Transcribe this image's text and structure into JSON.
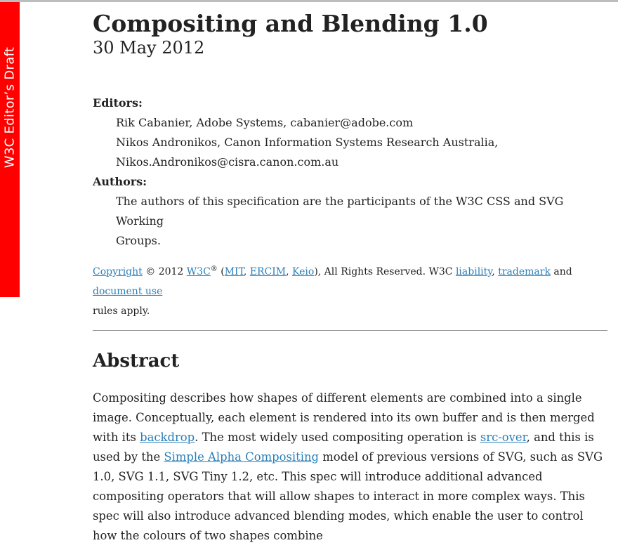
{
  "side_badge": {
    "text": "W3C Editor’s Draft",
    "color": "#ff0000"
  },
  "header": {
    "title": "Compositing and Blending 1.0",
    "date": "30 May 2012"
  },
  "meta": {
    "editors_label": "Editors:",
    "editor1": "Rik Cabanier, Adobe Systems, cabanier@adobe.com",
    "editor2_line1": "Nikos Andronikos, Canon Information Systems Research Australia,",
    "editor2_line2": "Nikos.Andronikos@cisra.canon.com.au",
    "authors_label": "Authors:",
    "authors_line1": "The authors of this specification are the participants of the W3C CSS and SVG Working",
    "authors_line2": "Groups."
  },
  "copyright": {
    "copyright_link": "Copyright",
    "year_text": " © 2012 ",
    "w3c_link": "W3C",
    "reg": "®",
    "open_paren": " (",
    "mit_link": "MIT",
    "comma1": ", ",
    "ercim_link": "ERCIM",
    "comma2": ", ",
    "keio_link": "Keio",
    "mid_text": "), All Rights Reserved. W3C ",
    "liability_link": "liability",
    "comma3": ", ",
    "trademark_link": "trademark",
    "and_text": " and ",
    "document_use_link": "document use",
    "rules_text": "rules apply."
  },
  "abstract": {
    "heading": "Abstract",
    "p1": "Compositing describes how shapes of different elements are combined into a single image. Conceptually, each element is rendered into its own buffer and is then merged with its ",
    "backdrop_link": "backdrop",
    "p2": ". The most widely used compositing operation is ",
    "src_over_link": "src-over",
    "p3": ", and this is used by the ",
    "simple_alpha_link": "Simple Alpha Compositing",
    "p4": " model of previous versions of SVG, such as SVG 1.0, SVG 1.1, SVG Tiny 1.2, etc. This spec will introduce additional advanced compositing operators that will allow shapes to interact in more complex ways. This spec will also introduce advanced blending modes, which enable the user to control how the colours of two shapes combine"
  },
  "colors": {
    "link": "#2a7fb8",
    "text": "#222222",
    "badge": "#ff0000"
  }
}
